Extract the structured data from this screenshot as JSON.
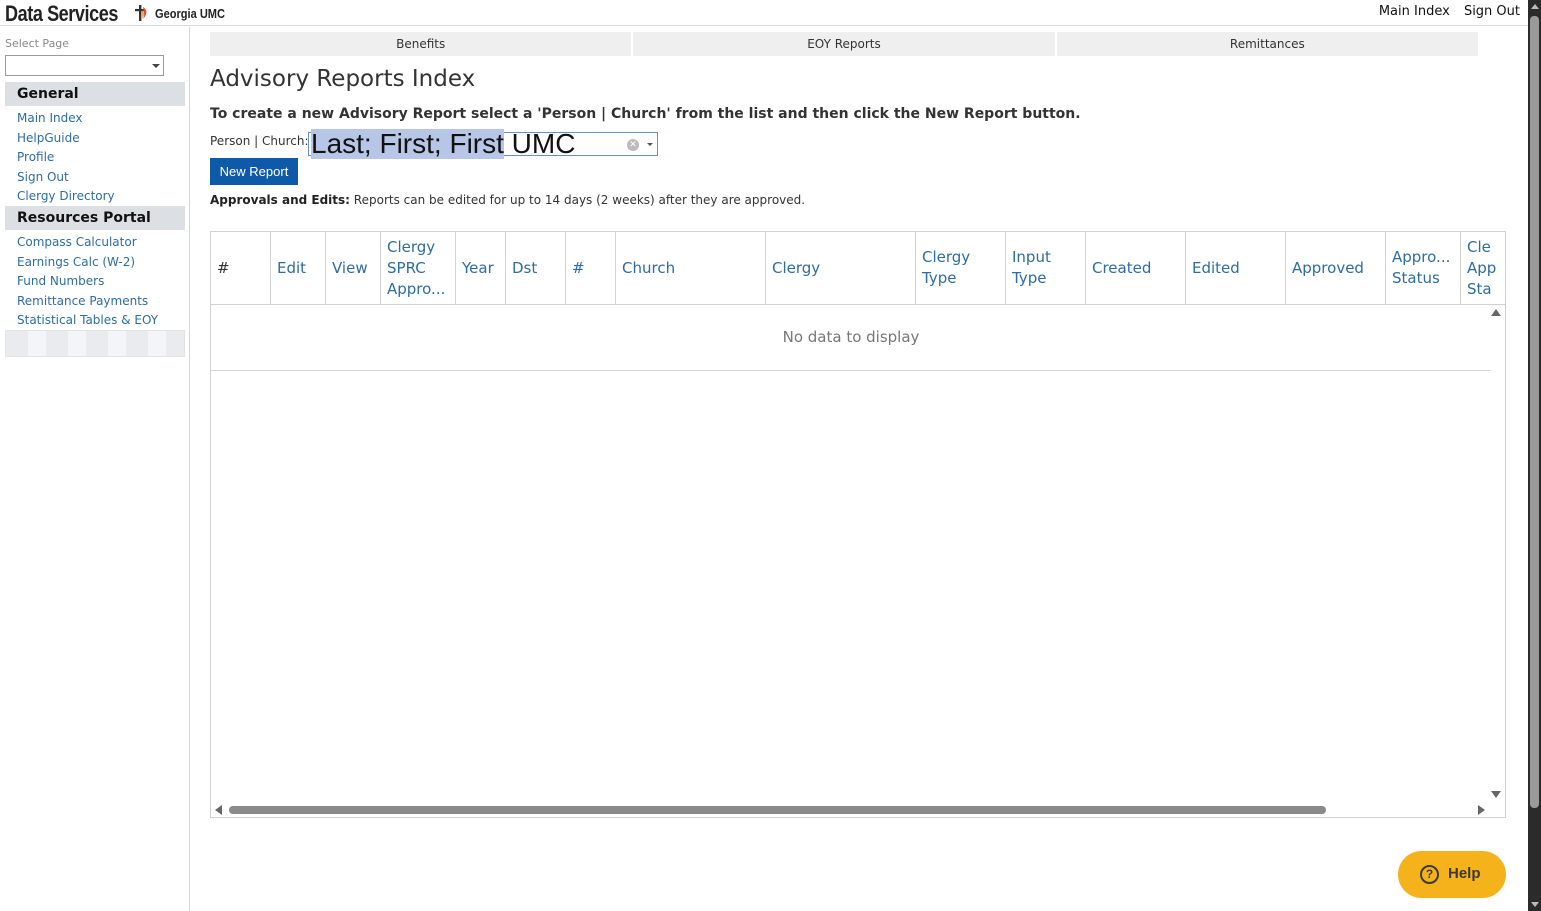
{
  "header": {
    "brand": "Data Services",
    "conference": "Georgia UMC",
    "links": [
      "Main Index",
      "Sign Out"
    ],
    "logo_color": "#d2522a"
  },
  "sidebar": {
    "select_label": "Select Page",
    "select_value": "",
    "sections": [
      {
        "title": "General",
        "items": [
          "Main Index",
          "HelpGuide",
          "Profile",
          "Sign Out",
          "Clergy Directory"
        ]
      },
      {
        "title": "Resources Portal",
        "items": [
          "Compass Calculator",
          "Earnings Calc (W-2)",
          "Fund Numbers",
          "Remittance Payments",
          "Statistical Tables & EOY"
        ]
      }
    ]
  },
  "tabs": [
    "Benefits",
    "EOY Reports",
    "Remittances"
  ],
  "main": {
    "title": "Advisory Reports Index",
    "instruction": "To create a new Advisory Report select a 'Person | Church' from the list and then click the New Report button.",
    "field_label": "Person | Church:",
    "combo_value": "Last; First; First UMC",
    "new_report_label": "New Report",
    "approvals_label": "Approvals and Edits:",
    "approvals_text": "Reports can be edited for up to 14 days (2 weeks) after they are approved."
  },
  "grid": {
    "columns": [
      "#",
      "Edit",
      "View",
      "Clergy SPRC Appro...",
      "Year",
      "Dst",
      "#",
      "Church",
      "Clergy",
      "Clergy Type",
      "Input Type",
      "Created",
      "Edited",
      "Approved",
      "Appro... Status",
      "Cle App Sta"
    ],
    "empty_text": "No data to display"
  },
  "help": {
    "label": "Help",
    "color": "#f6b21a"
  },
  "colors": {
    "link": "#2d6da3",
    "primary_button": "#0f5aa8"
  }
}
